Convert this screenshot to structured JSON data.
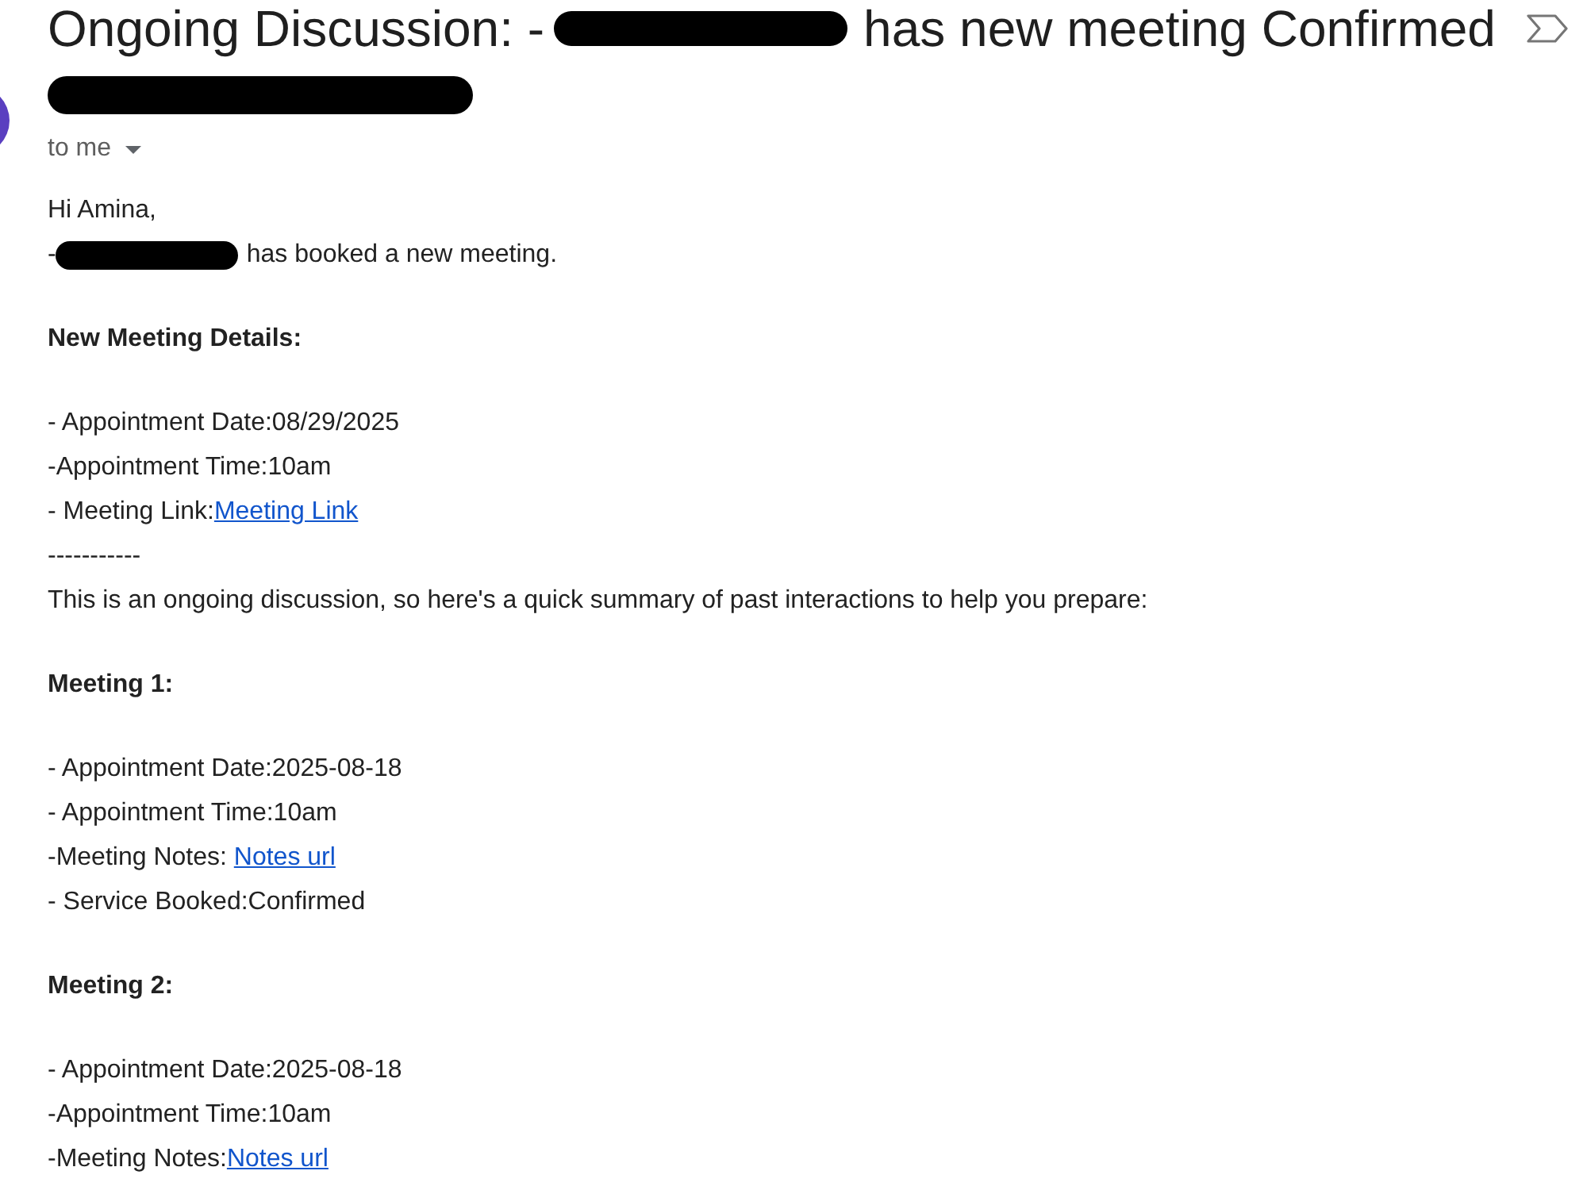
{
  "subject": [
    {
      "kind": "text",
      "text": "Ongoing Discussion: -"
    },
    {
      "kind": "redacted"
    },
    {
      "kind": "text",
      "text": "has new meeting Confirmed"
    }
  ],
  "sender": {
    "parts": [
      {
        "kind": "redacted"
      }
    ],
    "recipient": "to me"
  },
  "body": [
    {
      "lines": [
        {
          "kind": "plain",
          "parts": [
            {
              "kind": "text",
              "text": "Hi Amina,"
            }
          ]
        },
        {
          "kind": "plain",
          "parts": [
            {
              "kind": "text",
              "text": "-"
            },
            {
              "kind": "redacted"
            },
            {
              "kind": "text",
              "text": "has booked a new meeting."
            }
          ]
        }
      ]
    },
    {
      "lines": [
        {
          "kind": "bold",
          "parts": [
            {
              "kind": "text",
              "text": "New Meeting Details:"
            }
          ]
        }
      ]
    },
    {
      "lines": [
        {
          "kind": "plain",
          "parts": [
            {
              "kind": "text",
              "text": "- Appointment Date:08/29/2025"
            }
          ]
        },
        {
          "kind": "plain",
          "parts": [
            {
              "kind": "text",
              "text": "-Appointment Time:10am"
            }
          ]
        },
        {
          "kind": "plain",
          "parts": [
            {
              "kind": "text",
              "text": "- Meeting Link:"
            },
            {
              "kind": "link",
              "text": "Meeting Link"
            }
          ]
        },
        {
          "kind": "plain",
          "parts": [
            {
              "kind": "text",
              "text": "-----------"
            }
          ]
        },
        {
          "kind": "plain",
          "parts": [
            {
              "kind": "text",
              "text": "This is an ongoing discussion, so here's a quick summary of past interactions to help you prepare:"
            }
          ]
        }
      ]
    },
    {
      "lines": [
        {
          "kind": "bold",
          "parts": [
            {
              "kind": "text",
              "text": "Meeting 1:"
            }
          ]
        }
      ]
    },
    {
      "lines": [
        {
          "kind": "plain",
          "parts": [
            {
              "kind": "text",
              "text": "- Appointment Date:2025-08-18"
            }
          ]
        },
        {
          "kind": "plain",
          "parts": [
            {
              "kind": "text",
              "text": "- Appointment Time:10am"
            }
          ]
        },
        {
          "kind": "plain",
          "parts": [
            {
              "kind": "text",
              "text": "-Meeting Notes: "
            },
            {
              "kind": "link",
              "text": "Notes url"
            }
          ]
        },
        {
          "kind": "plain",
          "parts": [
            {
              "kind": "text",
              "text": "- Service Booked:Confirmed"
            }
          ]
        }
      ]
    },
    {
      "lines": [
        {
          "kind": "bold",
          "parts": [
            {
              "kind": "text",
              "text": "Meeting 2:"
            }
          ]
        }
      ]
    },
    {
      "lines": [
        {
          "kind": "plain",
          "parts": [
            {
              "kind": "text",
              "text": "- Appointment Date:2025-08-18"
            }
          ]
        },
        {
          "kind": "plain",
          "parts": [
            {
              "kind": "text",
              "text": "-Appointment Time:10am"
            }
          ]
        },
        {
          "kind": "plain",
          "parts": [
            {
              "kind": "text",
              "text": "-Meeting Notes:"
            },
            {
              "kind": "link",
              "text": "Notes url"
            }
          ]
        }
      ]
    }
  ]
}
